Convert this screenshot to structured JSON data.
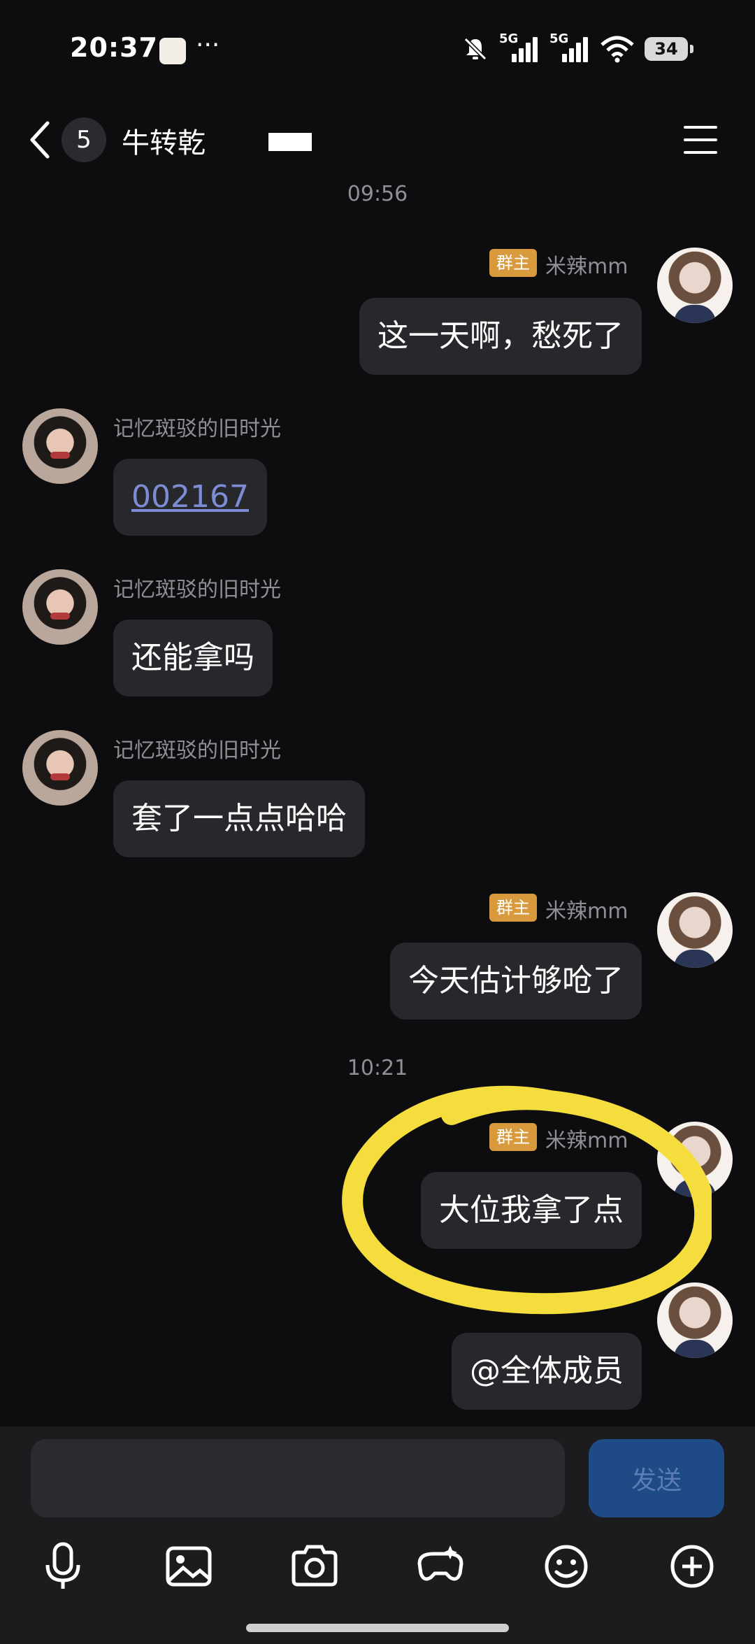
{
  "status_bar": {
    "time": "20:37",
    "dots": "···",
    "signal1": "5G",
    "signal2": "5G",
    "battery": "34"
  },
  "nav": {
    "count": "5",
    "title": "牛转乾"
  },
  "messages": [
    {
      "kind": "time",
      "text": "09:56"
    },
    {
      "kind": "out",
      "badge": "群主",
      "sender": "米辣mm",
      "text": "这一天啊，愁死了"
    },
    {
      "kind": "in",
      "sender": "记忆斑驳的旧时光",
      "text": "002167",
      "is_link": true
    },
    {
      "kind": "in",
      "sender": "记忆斑驳的旧时光",
      "text": "还能拿吗"
    },
    {
      "kind": "in",
      "sender": "记忆斑驳的旧时光",
      "text": "套了一点点哈哈"
    },
    {
      "kind": "out",
      "badge": "群主",
      "sender": "米辣mm",
      "text": "今天估计够呛了"
    },
    {
      "kind": "time",
      "text": "10:21"
    },
    {
      "kind": "out",
      "badge": "群主",
      "sender": "米辣mm",
      "text": "大位我拿了点"
    },
    {
      "kind": "out",
      "text": "@全体成员"
    }
  ],
  "composer": {
    "input_value": "",
    "send_label": "发送"
  },
  "toolbar": [
    "microphone-icon",
    "image-icon",
    "camera-icon",
    "game-icon",
    "emoji-icon",
    "plus-icon"
  ],
  "colors": {
    "background": "#0d0d0f",
    "bubble": "#27282c",
    "owner_badge": "#d89a3c",
    "send_button": "#1e4a86",
    "highlight_marker": "#f4dd3c",
    "link": "#7d8cd4"
  }
}
